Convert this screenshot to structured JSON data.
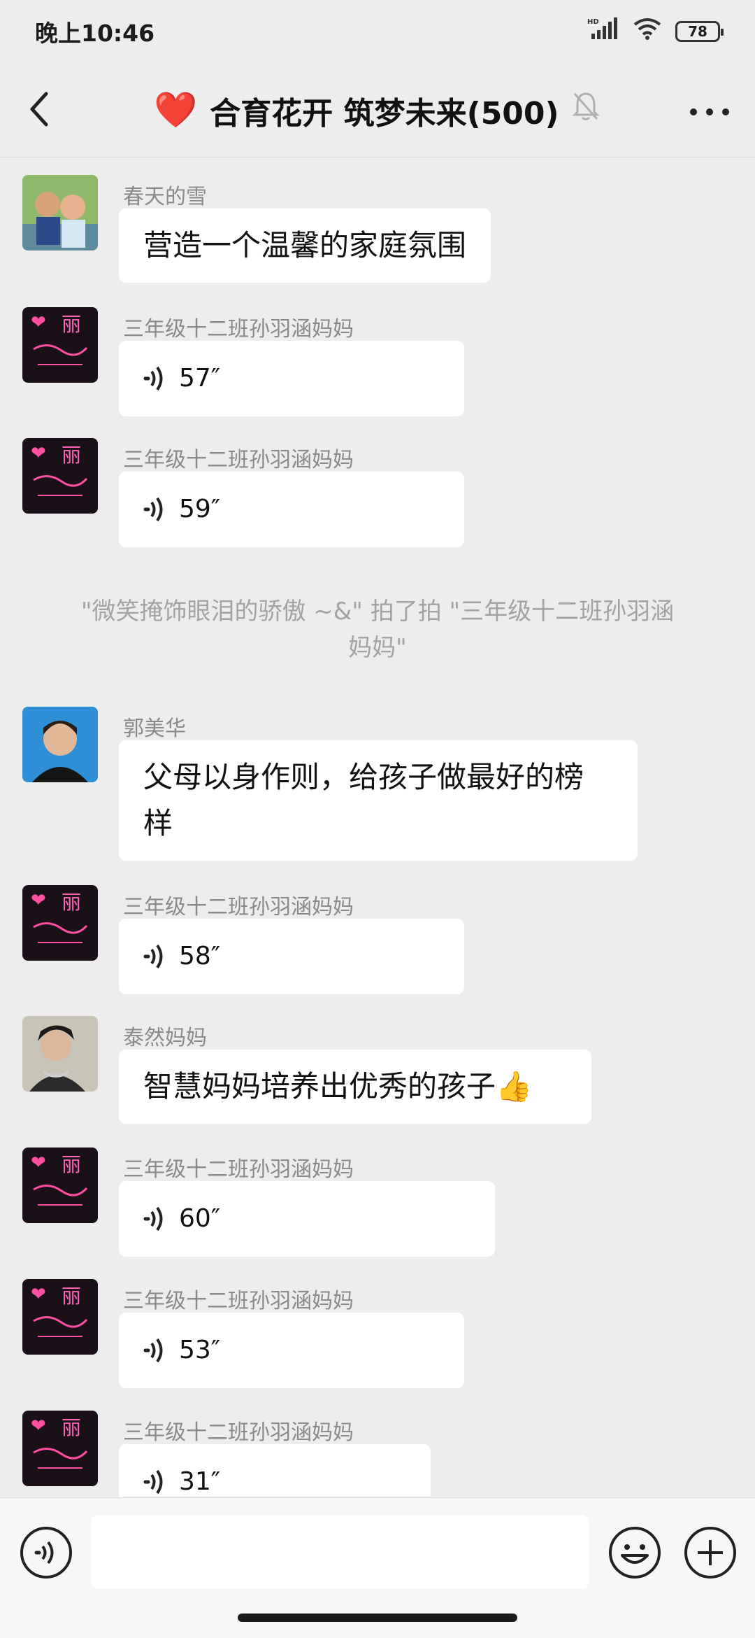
{
  "status": {
    "time": "晚上10:46",
    "battery": "78",
    "network_badge": "HD"
  },
  "nav": {
    "title": "合育花开 筑梦未来(500)",
    "emoji": "❤️"
  },
  "messages": [
    {
      "sender": "春天的雪",
      "text": "营造一个温馨的家庭氛围"
    },
    {
      "sender": "三年级十二班孙羽涵妈妈",
      "duration": "57″"
    },
    {
      "sender": "三年级十二班孙羽涵妈妈",
      "duration": "59″"
    },
    {
      "sender": "郭美华",
      "text_line1": "父母以身作则，给孩子做最好的榜",
      "text_line2": "样"
    },
    {
      "sender": "三年级十二班孙羽涵妈妈",
      "duration": "58″"
    },
    {
      "sender": "泰然妈妈",
      "text": "智慧妈妈培养出优秀的孩子👍"
    },
    {
      "sender": "三年级十二班孙羽涵妈妈",
      "duration": "60″"
    },
    {
      "sender": "三年级十二班孙羽涵妈妈",
      "duration": "53″"
    },
    {
      "sender": "三年级十二班孙羽涵妈妈",
      "duration": "31″"
    }
  ],
  "system_note": {
    "line1": "\"微笑掩饰眼泪的骄傲 ~&\" 拍了拍 \"三年级十二班孙羽涵",
    "line2": "妈妈\""
  },
  "avatar_sign_text": "丽",
  "colors": {
    "background": "#ededed",
    "bubble": "#ffffff",
    "sender": "#8a8a8a",
    "accent_pink": "#ff4fa3"
  }
}
